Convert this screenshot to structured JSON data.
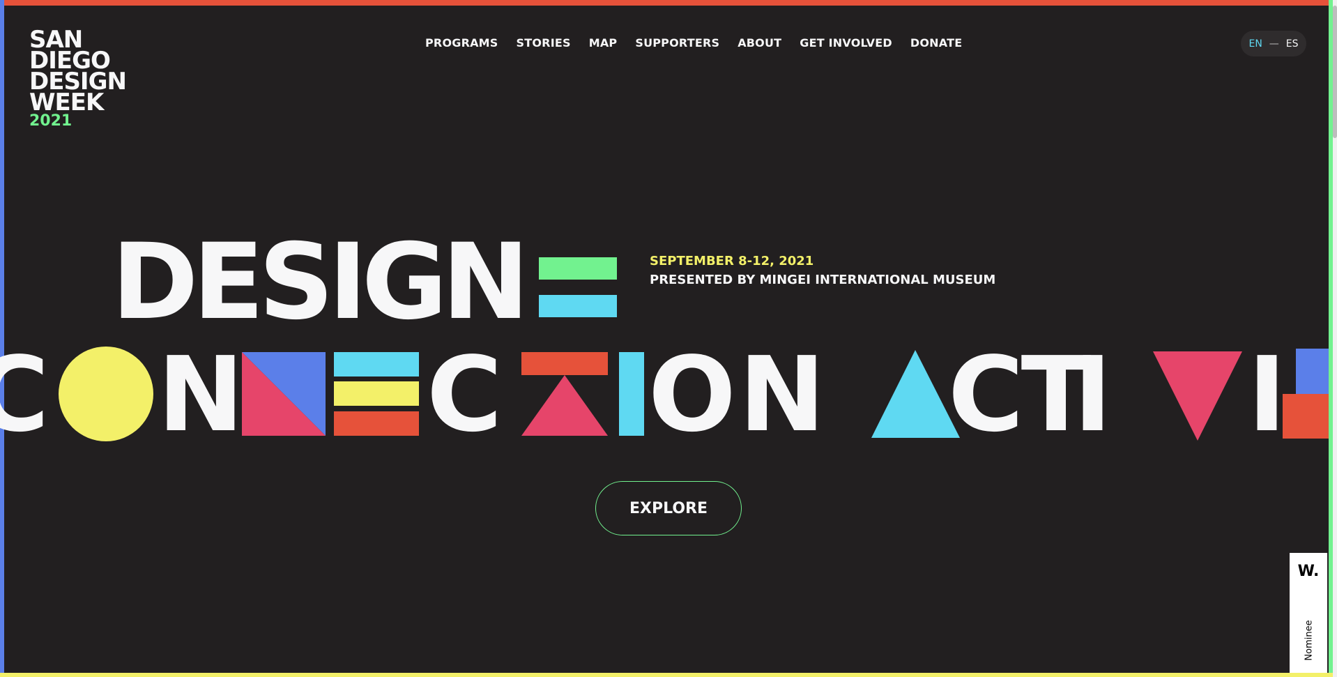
{
  "colors": {
    "background": "#221f20",
    "red": "#e6523a",
    "blue": "#5b7fe9",
    "yellow": "#f3f069",
    "green": "#72f28f",
    "cyan": "#5fd9f2",
    "pink": "#e6456a",
    "white": "#f7f7f8"
  },
  "logo": {
    "lines": [
      "SAN",
      "DIEGO",
      "DESIGN",
      "WEEK"
    ],
    "year": "2021"
  },
  "nav": {
    "items": [
      "PROGRAMS",
      "STORIES",
      "MAP",
      "SUPPORTERS",
      "ABOUT",
      "GET INVOLVED",
      "DONATE"
    ]
  },
  "language": {
    "active": "EN",
    "separator": "—",
    "other": "ES"
  },
  "hero": {
    "headline": "DESIGN",
    "event_date": "SEPTEMBER 8-12, 2021",
    "presenter": "PRESENTED BY MINGEI INTERNATIONAL MUSEUM",
    "marquee": "CONNECTION ACTIVI",
    "cta_label": "EXPLORE"
  },
  "award_badge": {
    "logo": "W.",
    "label": "Nominee"
  }
}
